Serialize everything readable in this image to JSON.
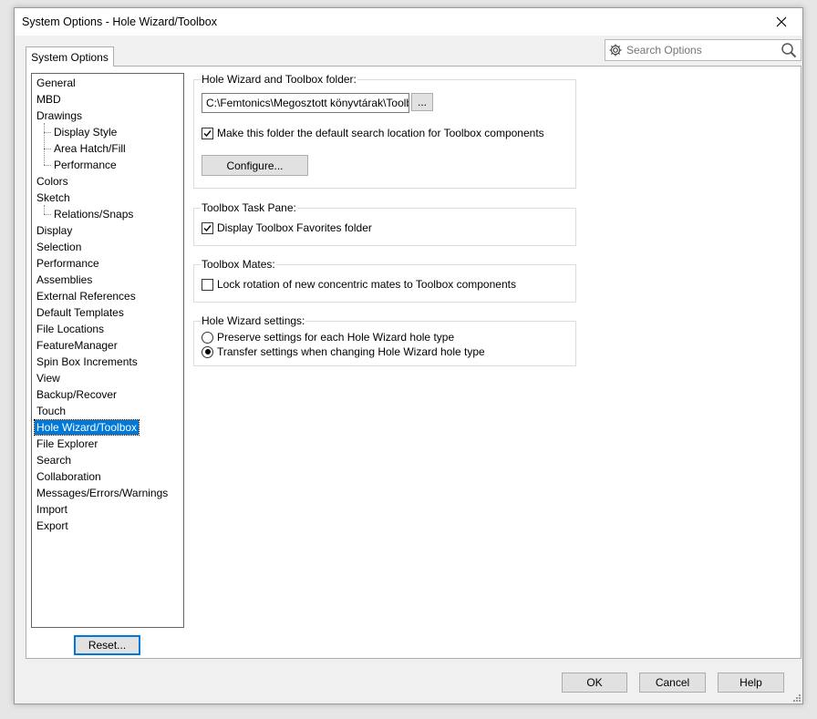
{
  "window": {
    "title": "System Options - Hole Wizard/Toolbox"
  },
  "tab": {
    "label": "System Options"
  },
  "search": {
    "placeholder": "Search Options"
  },
  "sidebar": {
    "items": [
      {
        "label": "General",
        "level": 0
      },
      {
        "label": "MBD",
        "level": 0
      },
      {
        "label": "Drawings",
        "level": 0
      },
      {
        "label": "Display Style",
        "level": 1
      },
      {
        "label": "Area Hatch/Fill",
        "level": 1
      },
      {
        "label": "Performance",
        "level": 1
      },
      {
        "label": "Colors",
        "level": 0
      },
      {
        "label": "Sketch",
        "level": 0
      },
      {
        "label": "Relations/Snaps",
        "level": 1
      },
      {
        "label": "Display",
        "level": 0
      },
      {
        "label": "Selection",
        "level": 0
      },
      {
        "label": "Performance",
        "level": 0
      },
      {
        "label": "Assemblies",
        "level": 0
      },
      {
        "label": "External References",
        "level": 0
      },
      {
        "label": "Default Templates",
        "level": 0
      },
      {
        "label": "File Locations",
        "level": 0
      },
      {
        "label": "FeatureManager",
        "level": 0
      },
      {
        "label": "Spin Box Increments",
        "level": 0
      },
      {
        "label": "View",
        "level": 0
      },
      {
        "label": "Backup/Recover",
        "level": 0
      },
      {
        "label": "Touch",
        "level": 0
      },
      {
        "label": "Hole Wizard/Toolbox",
        "level": 0,
        "selected": true
      },
      {
        "label": "File Explorer",
        "level": 0
      },
      {
        "label": "Search",
        "level": 0
      },
      {
        "label": "Collaboration",
        "level": 0
      },
      {
        "label": "Messages/Errors/Warnings",
        "level": 0
      },
      {
        "label": "Import",
        "level": 0
      },
      {
        "label": "Export",
        "level": 0
      }
    ],
    "reset_label": "Reset..."
  },
  "folder_group": {
    "label": "Hole Wizard and Toolbox folder:",
    "path_value": "C:\\Femtonics\\Megosztott könyvtárak\\Toolbox",
    "browse_label": "...",
    "default_search_label": "Make this folder the default search location for Toolbox components",
    "default_search_checked": true,
    "configure_label": "Configure..."
  },
  "task_pane_group": {
    "label": "Toolbox Task Pane:",
    "favorites_label": "Display Toolbox Favorites folder",
    "favorites_checked": true
  },
  "mates_group": {
    "label": "Toolbox Mates:",
    "lock_rotation_label": "Lock rotation of new concentric mates to Toolbox components",
    "lock_rotation_checked": false
  },
  "hole_wizard_group": {
    "label": "Hole Wizard settings:",
    "preserve_label": "Preserve settings for each Hole Wizard hole type",
    "transfer_label": "Transfer settings when changing Hole Wizard hole type",
    "selected_option": "transfer"
  },
  "footer": {
    "ok_label": "OK",
    "cancel_label": "Cancel",
    "help_label": "Help"
  },
  "colors": {
    "selection": "#0078d7",
    "window_bg": "#f0f0f0",
    "button_bg": "#e1e1e1"
  }
}
